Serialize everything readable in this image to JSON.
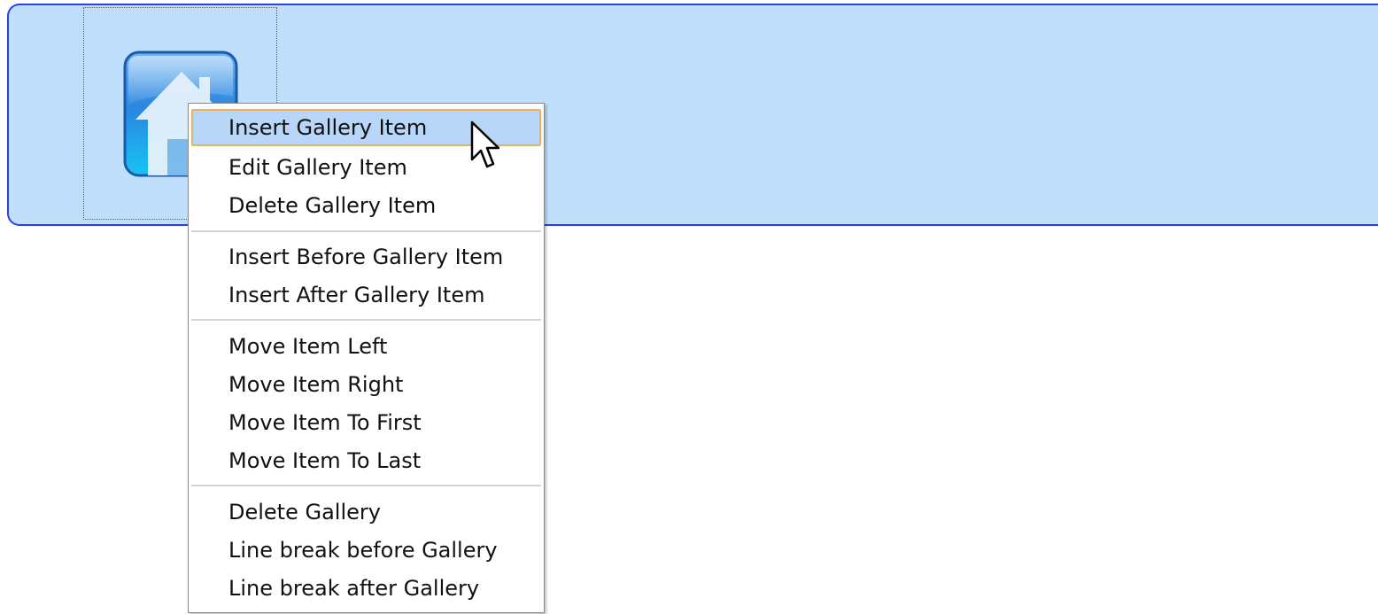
{
  "gallery": {
    "item_icon": "home-icon"
  },
  "context_menu": {
    "groups": [
      {
        "items": [
          {
            "label": "Insert Gallery Item",
            "highlighted": true
          },
          {
            "label": "Edit Gallery Item"
          },
          {
            "label": "Delete Gallery Item"
          }
        ]
      },
      {
        "items": [
          {
            "label": "Insert Before Gallery Item"
          },
          {
            "label": "Insert After Gallery Item"
          }
        ]
      },
      {
        "items": [
          {
            "label": "Move Item Left"
          },
          {
            "label": "Move Item Right"
          },
          {
            "label": "Move Item To First"
          },
          {
            "label": "Move Item To Last"
          }
        ]
      },
      {
        "items": [
          {
            "label": "Delete Gallery"
          },
          {
            "label": "Line break before Gallery"
          },
          {
            "label": "Line break after Gallery"
          }
        ]
      }
    ]
  },
  "colors": {
    "bar_background": "#bfdffd",
    "bar_border": "#2a3fe8",
    "highlight_background": "#b8d6f8",
    "highlight_border": "#e9b35a"
  },
  "cursor": "arrow-pointer"
}
